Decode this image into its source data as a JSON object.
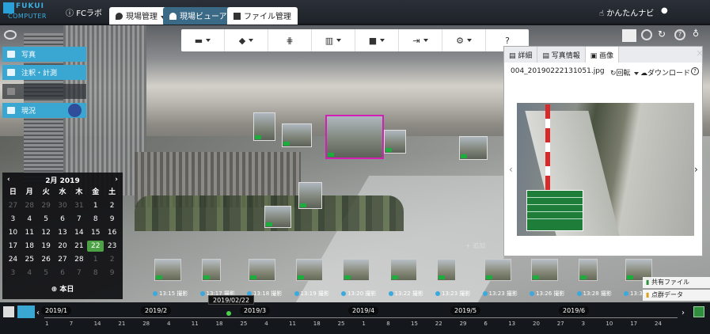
{
  "header": {
    "logo_line1": "FUKUI",
    "logo_line2": "COMPUTER",
    "org": "FCラボ",
    "tabs": [
      {
        "label": "現場管理"
      },
      {
        "label": "現場ビューア"
      },
      {
        "label": "ファイル管理"
      }
    ],
    "navi": "かんたんナビ"
  },
  "toolbar": [
    "measure",
    "tag",
    "tower",
    "chart",
    "video",
    "export",
    "settings",
    "help"
  ],
  "layers": [
    {
      "label": "写真"
    },
    {
      "label": "注釈・計測"
    },
    {
      "label": ""
    },
    {
      "label": "現況"
    }
  ],
  "calendar": {
    "title": "2月 2019",
    "prev": "‹",
    "next": "›",
    "weekdays": [
      "日",
      "月",
      "火",
      "水",
      "木",
      "金",
      "土"
    ],
    "days": [
      {
        "d": "27",
        "m": true
      },
      {
        "d": "28",
        "m": true
      },
      {
        "d": "29",
        "m": true
      },
      {
        "d": "30",
        "m": true
      },
      {
        "d": "31",
        "m": true
      },
      {
        "d": "1"
      },
      {
        "d": "2"
      },
      {
        "d": "3"
      },
      {
        "d": "4"
      },
      {
        "d": "5"
      },
      {
        "d": "6"
      },
      {
        "d": "7"
      },
      {
        "d": "8"
      },
      {
        "d": "9"
      },
      {
        "d": "10"
      },
      {
        "d": "11"
      },
      {
        "d": "12"
      },
      {
        "d": "13"
      },
      {
        "d": "14"
      },
      {
        "d": "15"
      },
      {
        "d": "16"
      },
      {
        "d": "17"
      },
      {
        "d": "18"
      },
      {
        "d": "19"
      },
      {
        "d": "20"
      },
      {
        "d": "21"
      },
      {
        "d": "22",
        "s": true
      },
      {
        "d": "23"
      },
      {
        "d": "24"
      },
      {
        "d": "25"
      },
      {
        "d": "26"
      },
      {
        "d": "27"
      },
      {
        "d": "28"
      },
      {
        "d": "1",
        "m": true
      },
      {
        "d": "2",
        "m": true
      },
      {
        "d": "3",
        "m": true
      },
      {
        "d": "4",
        "m": true
      },
      {
        "d": "5",
        "m": true
      },
      {
        "d": "6",
        "m": true
      },
      {
        "d": "7",
        "m": true
      },
      {
        "d": "8",
        "m": true
      },
      {
        "d": "9",
        "m": true
      }
    ],
    "today": "本日"
  },
  "panel": {
    "tabs": [
      "詳細",
      "写真情報",
      "画像"
    ],
    "filename": "004_20190222131051.jpg",
    "rotate": "回転",
    "download": "ダウンロード",
    "help": "?"
  },
  "filmstrip": {
    "add": "+ 追加",
    "items": [
      "13:15 撮影",
      "13:17 撮影",
      "13:18 撮影",
      "13:19 撮影",
      "13:20 撮影",
      "13:22 撮影",
      "13:23 撮影",
      "13:23 撮影",
      "13:26 撮影",
      "13:28 撮影",
      "13:32 撮影"
    ]
  },
  "side_buttons": {
    "shared": "共有ファイル",
    "points": "点群データ"
  },
  "timeline": {
    "months": [
      "2019/1",
      "2019/2",
      "2019/3",
      "2019/4",
      "2019/5",
      "2019/6"
    ],
    "ticks": [
      "1",
      "7",
      "14",
      "21",
      "28",
      "4",
      "11",
      "18",
      "25",
      "4",
      "11",
      "18",
      "25",
      "1",
      "8",
      "15",
      "22",
      "29",
      "6",
      "13",
      "20",
      "27",
      "3",
      "10",
      "17",
      "24"
    ],
    "current": "2019/02/22"
  }
}
